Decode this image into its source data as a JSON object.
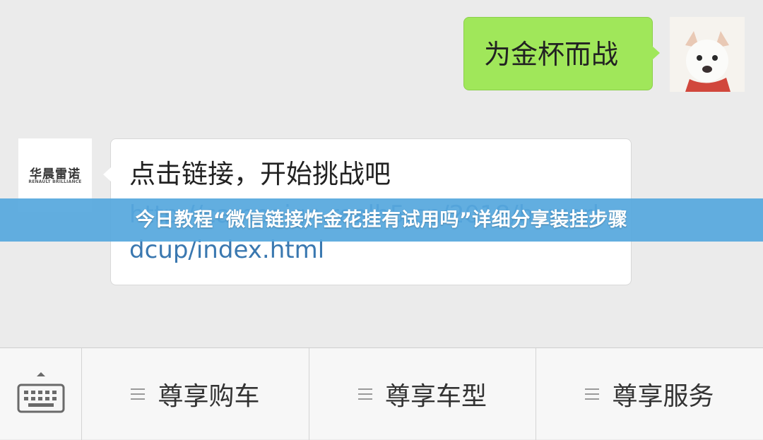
{
  "messages": {
    "outgoing": {
      "text": "为金杯而战"
    },
    "incoming": {
      "brand_name_cn": "华晨雷诺",
      "brand_name_en": "RENAULT BRILLIANCE",
      "text": "点击链接，开始挑战吧",
      "link": "http://campaign.realh5.cn/2018/howorldcup/index.html"
    }
  },
  "banner": {
    "title": "今日教程“微信链接炸金花挂有试用吗”详细分享装挂步骤"
  },
  "menu": {
    "keyboard_icon": "keyboard-icon",
    "items": [
      {
        "label": "尊享购车",
        "icon": "menu-lines-icon"
      },
      {
        "label": "尊享车型",
        "icon": "menu-lines-icon"
      },
      {
        "label": "尊享服务",
        "icon": "menu-lines-icon"
      }
    ]
  },
  "colors": {
    "outgoing_bubble": "#a0e75a",
    "link": "#3a78b0",
    "banner": "#56a8de"
  }
}
